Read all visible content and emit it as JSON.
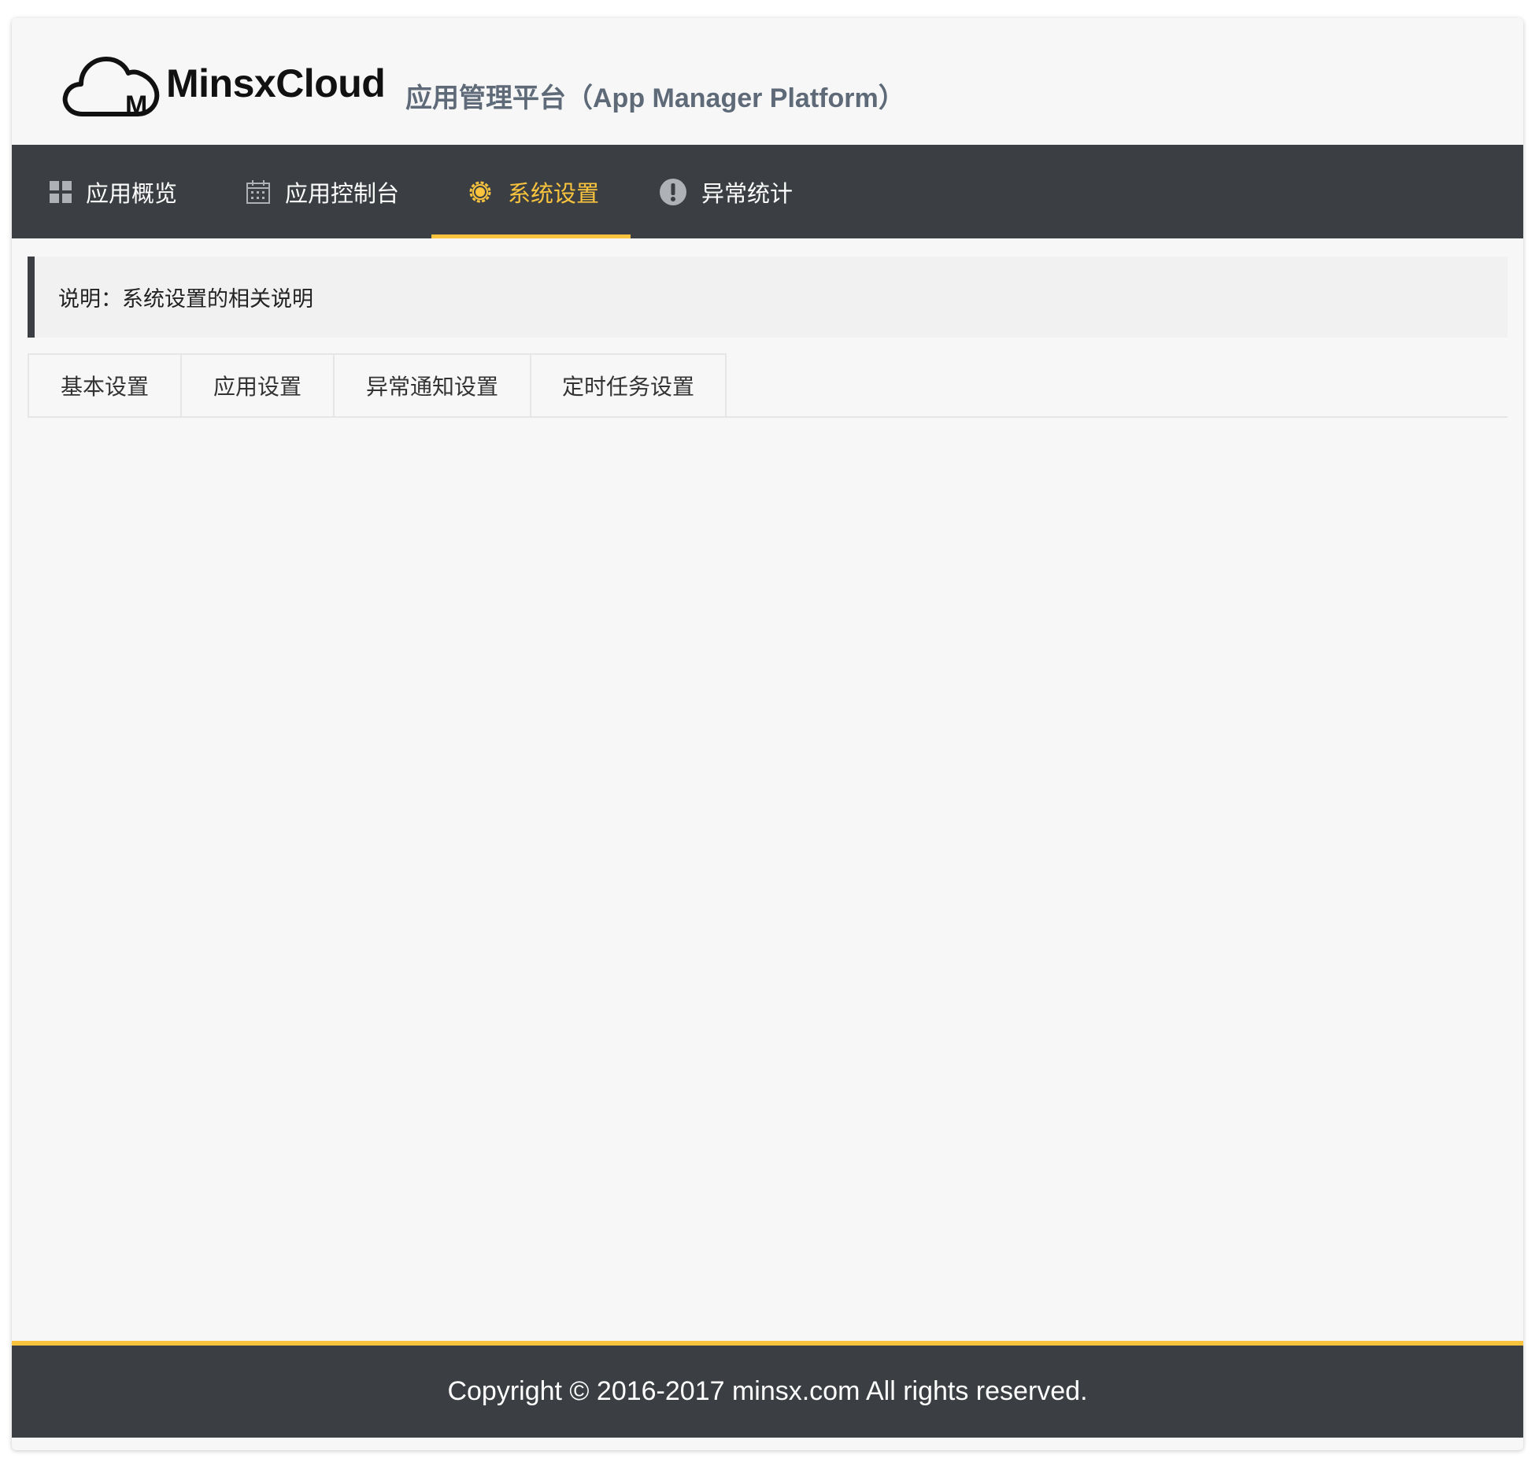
{
  "header": {
    "brand": "MinsxCloud",
    "platform_title": "应用管理平台（App Manager Platform）"
  },
  "nav": {
    "items": [
      {
        "label": "应用概览",
        "icon": "grid-icon",
        "active": false
      },
      {
        "label": "应用控制台",
        "icon": "calendar-icon",
        "active": false
      },
      {
        "label": "系统设置",
        "icon": "gear-icon",
        "active": true
      },
      {
        "label": "异常统计",
        "icon": "exclamation-icon",
        "active": false
      }
    ]
  },
  "notice": {
    "text": "说明：系统设置的相关说明"
  },
  "tabs": [
    {
      "label": "基本设置"
    },
    {
      "label": "应用设置"
    },
    {
      "label": "异常通知设置"
    },
    {
      "label": "定时任务设置"
    }
  ],
  "footer": {
    "copyright": "Copyright © 2016-2017 minsx.com All rights reserved."
  },
  "colors": {
    "accent": "#f9c33e",
    "nav_bg": "#3b3f43",
    "page_bg": "#f7f7f7",
    "platform_title": "#5f6a78"
  }
}
